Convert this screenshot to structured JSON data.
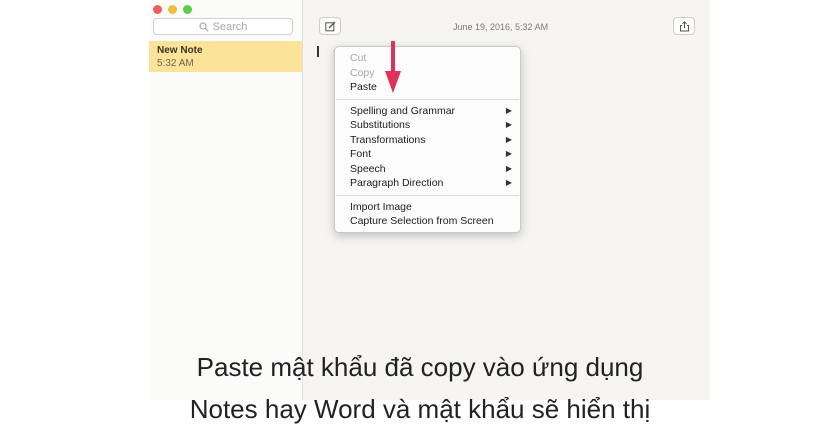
{
  "sidebar": {
    "search": {
      "placeholder": "Search"
    },
    "notes": [
      {
        "title": "New Note",
        "time": "5:32 AM"
      }
    ]
  },
  "editor": {
    "date": "June 19, 2016, 5:32 AM"
  },
  "context_menu": {
    "groups": [
      [
        {
          "label": "Cut",
          "enabled": false
        },
        {
          "label": "Copy",
          "enabled": false
        },
        {
          "label": "Paste",
          "enabled": true
        }
      ],
      [
        {
          "label": "Spelling and Grammar",
          "submenu": true
        },
        {
          "label": "Substitutions",
          "submenu": true
        },
        {
          "label": "Transformations",
          "submenu": true
        },
        {
          "label": "Font",
          "submenu": true
        },
        {
          "label": "Speech",
          "submenu": true
        },
        {
          "label": "Paragraph Direction",
          "submenu": true
        }
      ],
      [
        {
          "label": "Import Image",
          "submenu": false
        },
        {
          "label": "Capture Selection from Screen",
          "submenu": false
        }
      ]
    ],
    "submenu_glyph": "▶"
  },
  "caption": {
    "line1": "Paste mật khẩu đã copy vào ứng dụng",
    "line2": "Notes hay Word và mật khẩu sẽ hiển thị"
  },
  "colors": {
    "accent_arrow": "#e0315a",
    "note_highlight": "#fbe39a",
    "close": "#ef5f57",
    "minimize": "#f2bd3a",
    "maximize": "#5fcb49"
  },
  "icons": [
    "search-icon",
    "new-note-icon",
    "share-icon",
    "pointer-cursor-icon",
    "submenu-arrow-icon"
  ]
}
